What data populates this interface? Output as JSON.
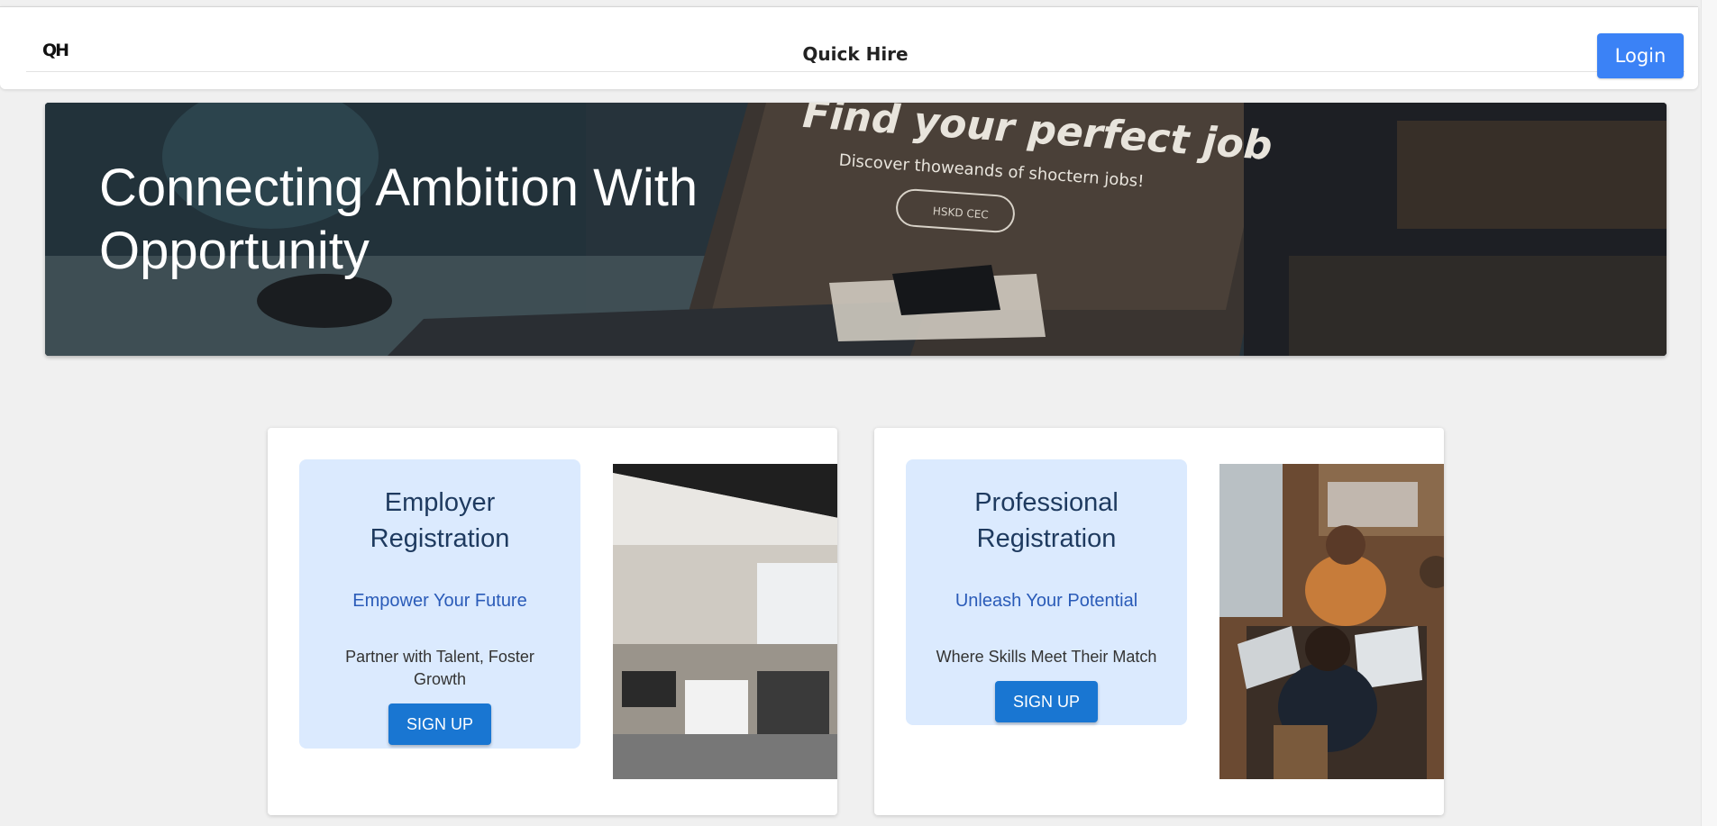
{
  "header": {
    "logo": "QH",
    "title": "Quick Hire",
    "login_label": "Login"
  },
  "hero": {
    "headline": "Connecting Ambition With Opportunity",
    "image_text": {
      "heading": "Find your perfect job",
      "subheading": "Discover thoweands of shoctern jobs!",
      "button": "HSKD CEC"
    }
  },
  "cards": {
    "employer": {
      "title": "Employer Registration",
      "tagline": "Empower Your Future",
      "description": "Partner with Talent, Foster Growth",
      "button": "SIGN UP"
    },
    "professional": {
      "title": "Professional Registration",
      "tagline": "Unleash Your Potential",
      "description": "Where Skills Meet Their Match",
      "button": "SIGN UP"
    }
  },
  "colors": {
    "page_bg": "#f0f0f0",
    "accent": "#3b82f6",
    "signup_button": "#1976d2",
    "panel_bg": "#dbeafe",
    "panel_title": "#1e3a5f",
    "panel_tagline": "#2a5bb8"
  },
  "icons": {
    "hero_image": "laptop-desk-photo",
    "employer_image": "open-office-photo",
    "professional_image": "team-laptops-photo"
  }
}
